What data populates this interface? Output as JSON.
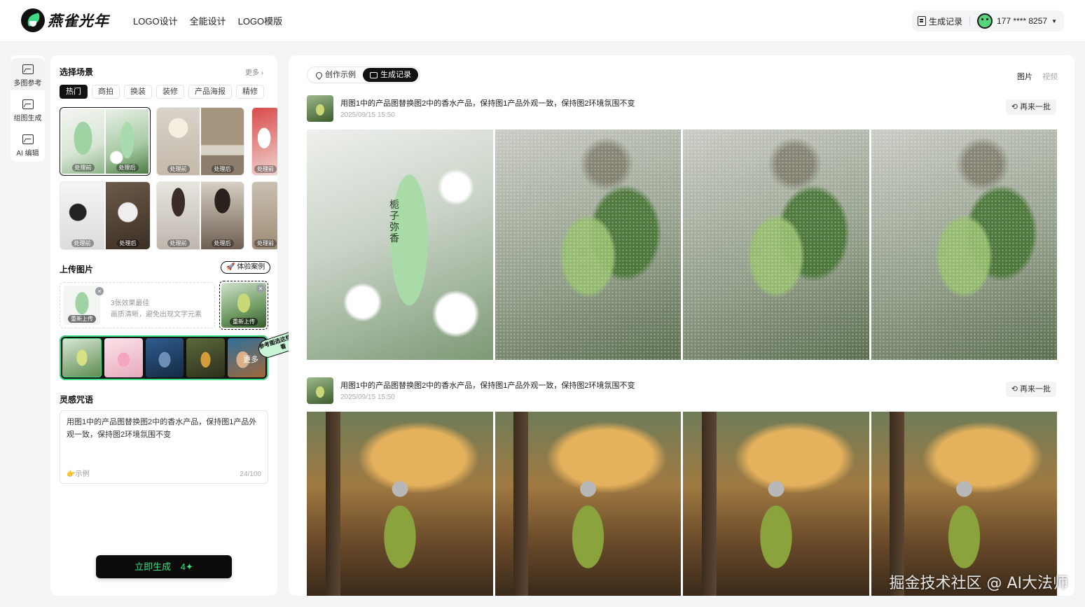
{
  "header": {
    "brand": "燕雀光年",
    "nav": [
      "LOGO设计",
      "全能设计",
      "LOGO模版"
    ],
    "history_label": "生成记录",
    "user_phone": "177 **** 8257"
  },
  "rail": [
    {
      "label": "多图参考"
    },
    {
      "label": "组图生成"
    },
    {
      "label": "AI 编辑"
    }
  ],
  "panel": {
    "scene_title": "选择场景",
    "more_label": "更多 ›",
    "chips": [
      "热门",
      "商拍",
      "换装",
      "装修",
      "产品海报",
      "精修"
    ],
    "before_label": "处理前",
    "after_label": "处理后",
    "upload_title": "上传图片",
    "experience_label": "体验案例",
    "reupload_label": "重新上传",
    "upload_hint1": "3张效果最佳",
    "upload_hint2": "画质清晰，避免出现文字元素",
    "ref_more_label": "更多",
    "sticker_text": "参考图选这些 试试看",
    "prompt_title": "灵感咒语",
    "prompt_text": "用图1中的产品图替换图2中的香水产品，保持图1产品外观一致，保持图2环境氛围不变",
    "example_label": "示例",
    "counter": "24/100",
    "generate_label": "立即生成",
    "generate_cost": "4"
  },
  "main": {
    "tabs": [
      "创作示例",
      "生成记录"
    ],
    "media_tabs": [
      "图片",
      "视频"
    ],
    "hero_product_text": "栀子弥香",
    "retry_label": "再来一批",
    "records": [
      {
        "prompt": "用图1中的产品图替换图2中的香水产品，保持图1产品外观一致，保持图2环境氛围不变",
        "date": "2025/09/15  15:50"
      },
      {
        "prompt": "用图1中的产品图替换图2中的香水产品，保持图1产品外观一致，保持图2环境氛围不变",
        "date": "2025/09/15  15:50"
      }
    ]
  },
  "watermark": "掘金技术社区 @ AI大法师"
}
